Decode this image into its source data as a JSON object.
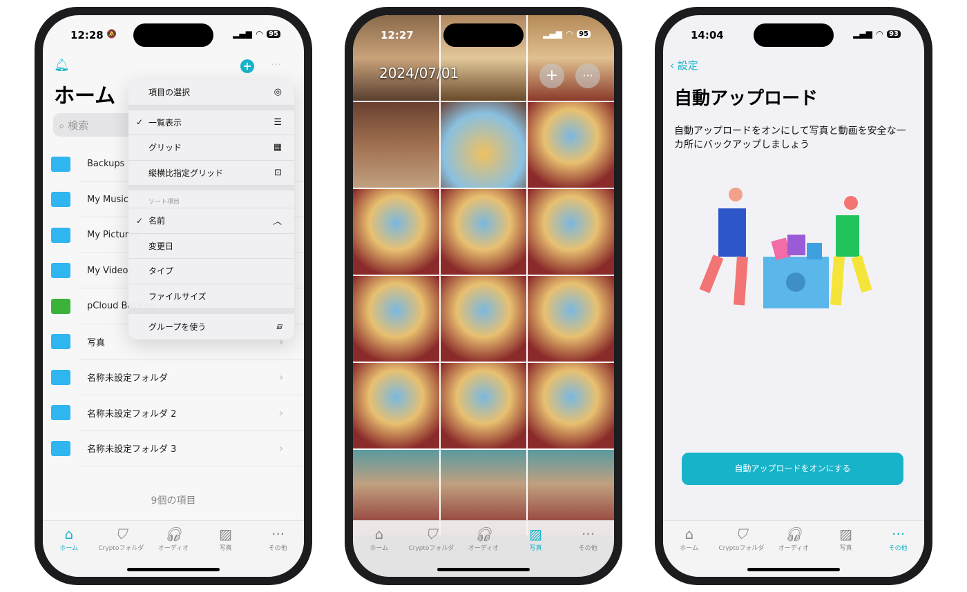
{
  "phone1": {
    "time": "12:28",
    "battery": "95",
    "title": "ホーム",
    "search_placeholder": "検索",
    "folders": [
      {
        "name": "Backups"
      },
      {
        "name": "My Music"
      },
      {
        "name": "My Pictures"
      },
      {
        "name": "My Videos"
      },
      {
        "name": "pCloud Backup"
      },
      {
        "name": "写真"
      },
      {
        "name": "名称未設定フォルダ"
      },
      {
        "name": "名称未設定フォルダ 2"
      },
      {
        "name": "名称未設定フォルダ 3"
      }
    ],
    "item_count": "9個の項目",
    "menu": {
      "select": "項目の選択",
      "list": "一覧表示",
      "grid": "グリッド",
      "aspect_grid": "縦横比指定グリッド",
      "sort_header": "ソート項目",
      "name": "名前",
      "modified": "変更日",
      "type": "タイプ",
      "size": "ファイルサイズ",
      "group": "グループを使う"
    },
    "accent": "#17b3c9"
  },
  "phone2": {
    "time": "12:27",
    "battery": "95",
    "date": "2024/07/01"
  },
  "phone3": {
    "time": "14:04",
    "battery": "93",
    "back": "設定",
    "title": "自動アップロード",
    "description": "自動アップロードをオンにして写真と動画を安全な一カ所にバックアップしましょう",
    "button": "自動アップロードをオンにする"
  },
  "tabs": {
    "home": "ホーム",
    "crypto": "Cryptoフォルダ",
    "audio": "オーディオ",
    "photos": "写真",
    "more": "その他"
  }
}
